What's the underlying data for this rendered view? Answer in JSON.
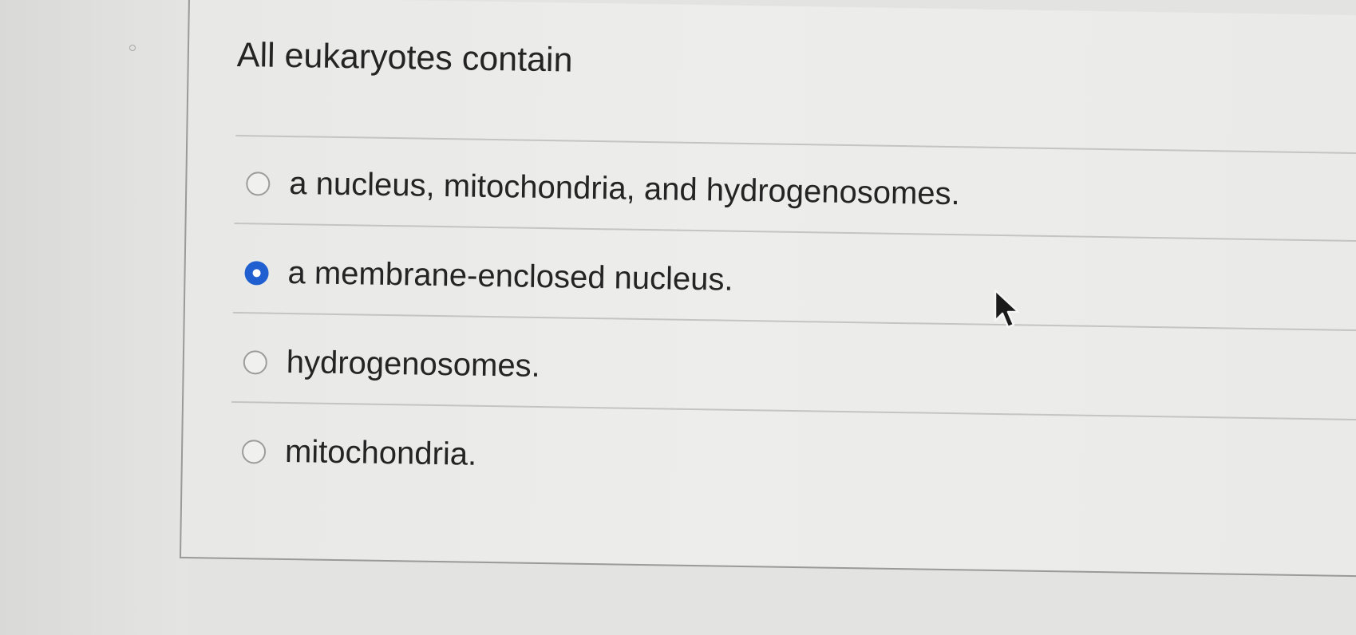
{
  "question": {
    "text": "All eukaryotes contain"
  },
  "options": [
    {
      "label": "a nucleus, mitochondria, and hydrogenosomes.",
      "selected": false
    },
    {
      "label": "a membrane-enclosed nucleus.",
      "selected": true
    },
    {
      "label": "hydrogenosomes.",
      "selected": false
    },
    {
      "label": "mitochondria.",
      "selected": false
    }
  ],
  "colors": {
    "selected_radio": "#1f5fd0",
    "text": "#242424"
  },
  "icons": {
    "cursor": "mouse-pointer-icon",
    "marker": "small-circle-icon"
  }
}
